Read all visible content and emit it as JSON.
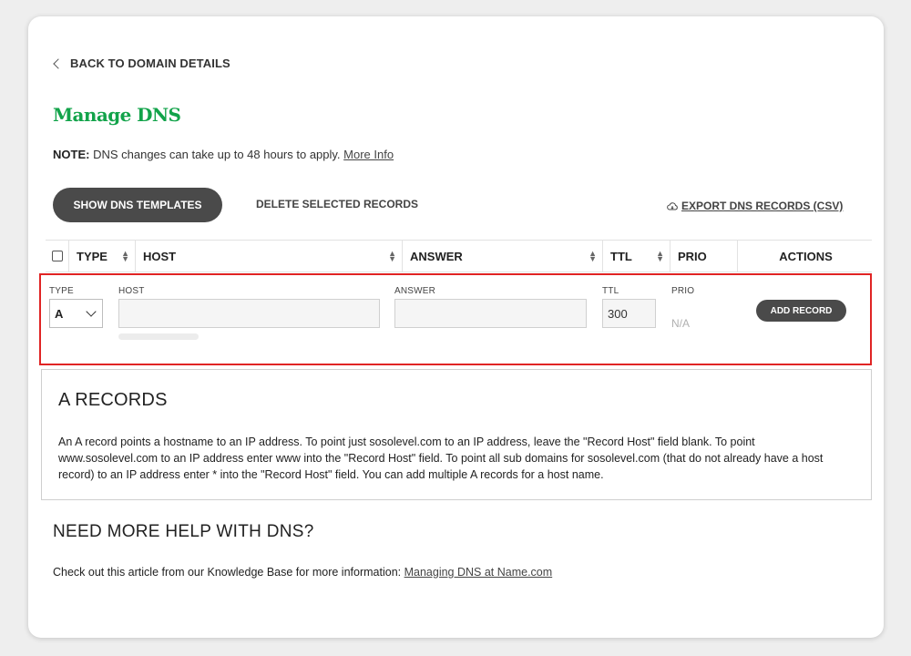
{
  "back_link": "BACK TO DOMAIN DETAILS",
  "page_title": "Manage DNS",
  "note": {
    "label": "NOTE:",
    "text": " DNS changes can take up to 48 hours to apply. ",
    "link": "More Info"
  },
  "toolbar": {
    "templates_button": "SHOW DNS TEMPLATES",
    "delete_button": "DELETE SELECTED RECORDS",
    "export_link": "EXPORT DNS RECORDS (CSV)"
  },
  "table_headers": {
    "type": "TYPE",
    "host": "HOST",
    "answer": "ANSWER",
    "ttl": "TTL",
    "prio": "PRIO",
    "actions": "ACTIONS"
  },
  "add_form": {
    "type_label": "TYPE",
    "type_value": "A",
    "host_label": "HOST",
    "host_value": "",
    "answer_label": "ANSWER",
    "answer_value": "",
    "ttl_label": "TTL",
    "ttl_value": "300",
    "prio_label": "PRIO",
    "prio_value": "N/A",
    "add_button": "ADD RECORD",
    "highlight_color": "#e02424"
  },
  "info": {
    "heading": "A RECORDS",
    "body": "An A record points a hostname to an IP address. To point just sosolevel.com to an IP address, leave the \"Record Host\" field blank. To point www.sosolevel.com to an IP address enter www into the \"Record Host\" field. To point all sub domains for sosolevel.com (that do not already have a host record) to an IP address enter * into the \"Record Host\" field. You can add multiple A records for a host name."
  },
  "help": {
    "heading": "NEED MORE HELP WITH DNS?",
    "text": "Check out this article from our Knowledge Base for more information: ",
    "link": "Managing DNS at Name.com"
  },
  "colors": {
    "brand_green": "#12a34a",
    "dark_button": "#4a4a4a"
  }
}
